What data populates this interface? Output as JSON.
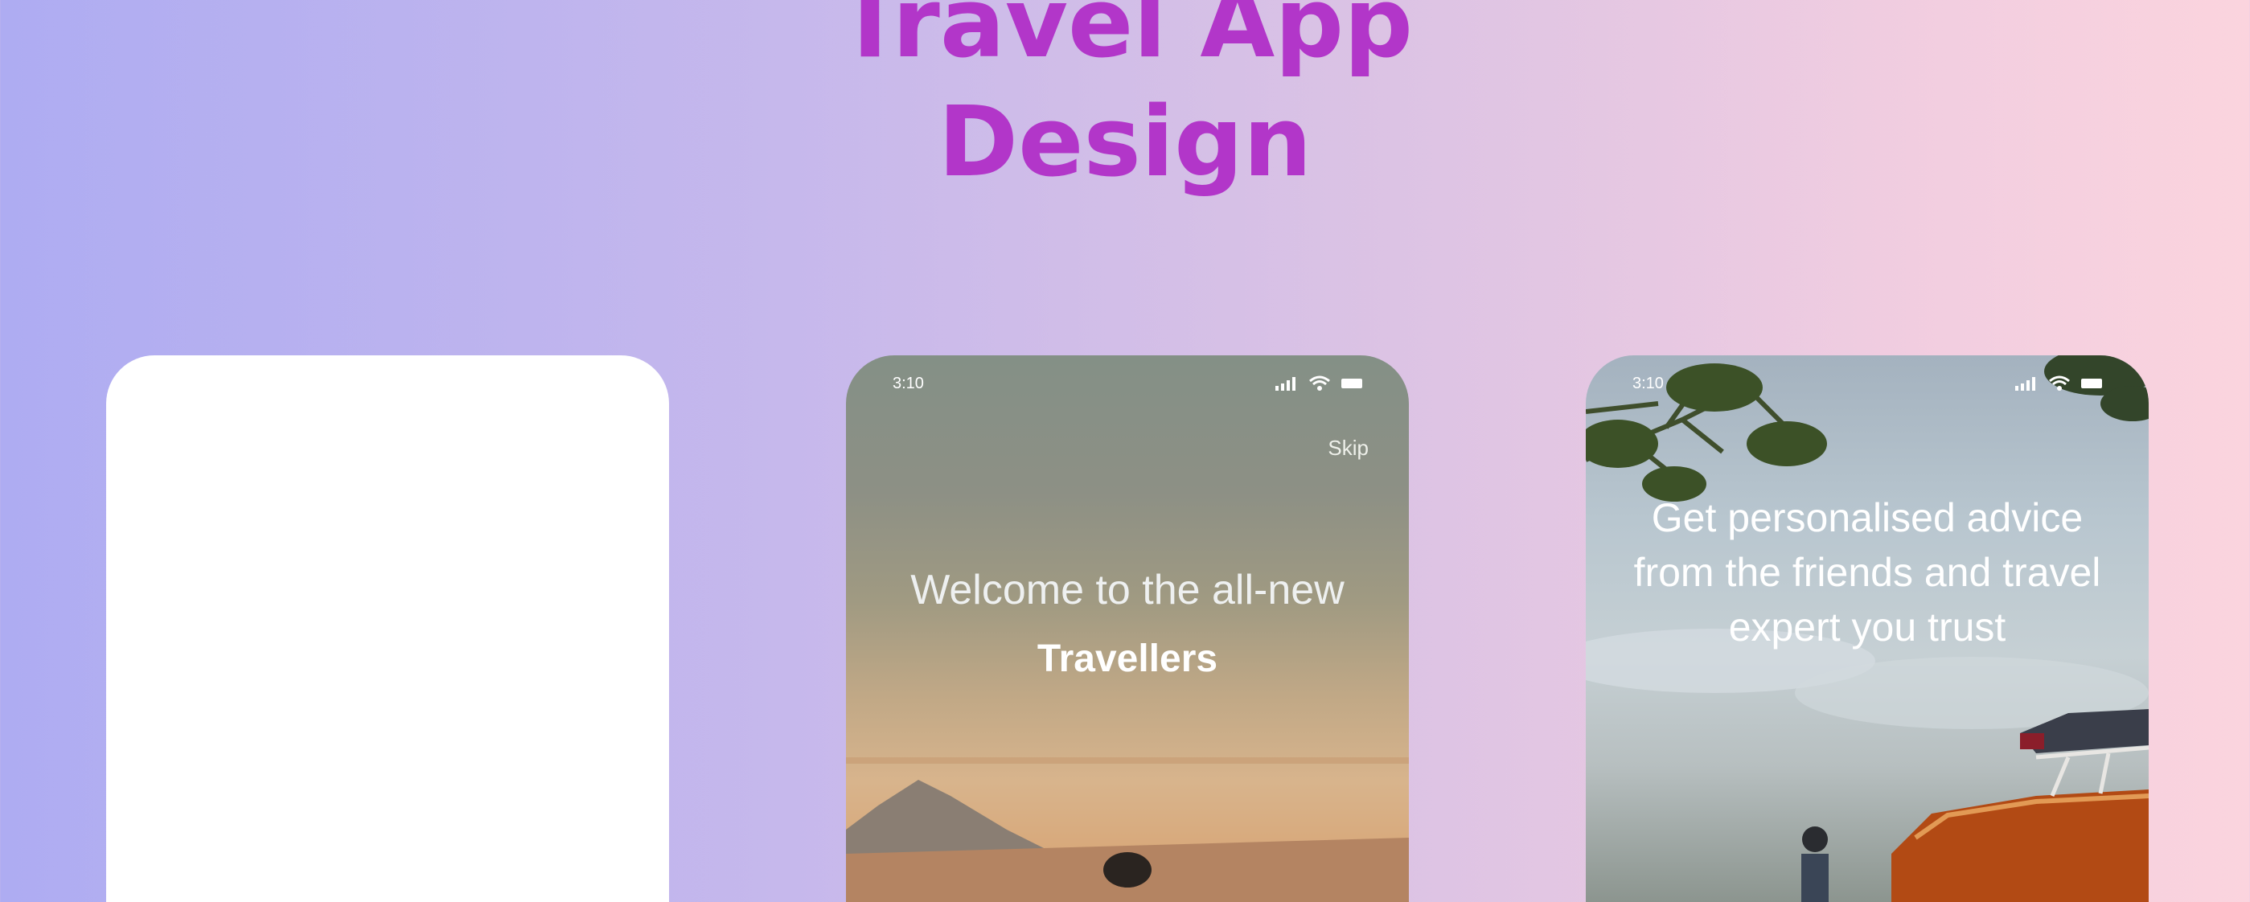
{
  "header": {
    "title_line1": "Travel App",
    "title_line2": "Design"
  },
  "colors": {
    "title": "#b236c9",
    "background_start": "#aeacf2",
    "background_end": "#fbd4de"
  },
  "screens": [
    {
      "id": "blank"
    },
    {
      "id": "welcome",
      "status": {
        "time": "3:10",
        "icons": [
          "signal-icon",
          "wifi-icon",
          "battery-icon"
        ]
      },
      "skip_label": "Skip",
      "welcome_text": "Welcome to the all-new",
      "brand_text": "Travellers"
    },
    {
      "id": "advice",
      "status": {
        "time": "3:10",
        "icons": [
          "signal-icon",
          "wifi-icon",
          "battery-icon"
        ]
      },
      "headline_lines": [
        "Get personalised advice",
        "from the friends and travel",
        "expert you trust"
      ]
    }
  ]
}
